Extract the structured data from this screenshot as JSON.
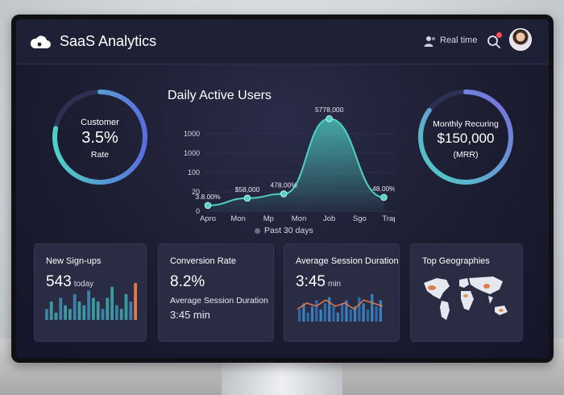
{
  "header": {
    "title": "SaaS Analytics",
    "realtime_label": "Real time",
    "icons": {
      "logo": "cloud-icon",
      "realtime": "users-icon",
      "search": "search-icon",
      "avatar": "user-avatar"
    }
  },
  "gauges": {
    "left": {
      "label_top": "Customer",
      "value": "3.5%",
      "label_bottom": "Rate",
      "fill": 0.78
    },
    "right": {
      "label_top": "Monthly Recuring",
      "value": "$150,000",
      "label_bottom": "(MRR)",
      "fill": 0.85
    }
  },
  "colors": {
    "teal": "#4fd1c5",
    "purple": "#7a6ae0",
    "blue": "#4f7fe0",
    "orange": "#e07a4f"
  },
  "chart_data": {
    "type": "area",
    "title": "Daily Active Users",
    "x_ticks": [
      "Apro",
      "Mon",
      "Mp",
      "Mon",
      "Job",
      "Sgo",
      "Trap"
    ],
    "y_ticks": [
      "1000",
      "1000",
      "100",
      "20",
      "0"
    ],
    "points": [
      {
        "x": 0.0,
        "y": 20,
        "label": "3.8.00%"
      },
      {
        "x": 1.3,
        "y": 45,
        "label": "$58,000"
      },
      {
        "x": 2.5,
        "y": 60,
        "label": "478.00%"
      },
      {
        "x": 4.0,
        "y": 320,
        "label": "5778,000"
      },
      {
        "x": 5.8,
        "y": 48,
        "label": "48.00%"
      }
    ],
    "legend": "Past 30 days"
  },
  "cards": [
    {
      "title": "New Sign-ups",
      "value": "543",
      "unit": "today"
    },
    {
      "title": "Conversion Rate",
      "value": "8.2%",
      "sub_label": "Average Session Duration",
      "sub_value": "3:45 min"
    },
    {
      "title": "Average Session Duration",
      "value": "3:45",
      "unit": "min"
    },
    {
      "title": "Top Geographies"
    }
  ],
  "signup_bars": [
    3,
    5,
    2,
    6,
    4,
    3,
    7,
    5,
    4,
    8,
    6,
    5,
    3,
    6,
    9,
    4,
    3,
    7,
    5,
    10
  ],
  "session_bars": [
    4,
    6,
    3,
    5,
    7,
    4,
    6,
    8,
    5,
    3,
    6,
    7,
    4,
    5,
    8,
    6,
    4,
    9,
    5,
    7
  ],
  "session_trend": [
    3,
    5,
    4,
    6,
    4,
    5,
    3,
    6,
    5,
    4
  ]
}
